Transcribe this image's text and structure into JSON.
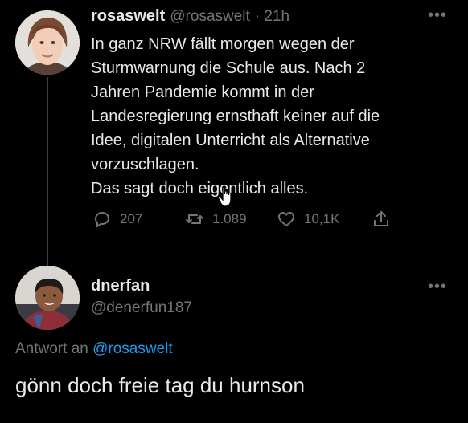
{
  "tweet": {
    "display_name": "rosaswelt",
    "handle": "@rosaswelt",
    "time": "· 21h",
    "more_icon": "more-dots-icon",
    "text": "In ganz NRW fällt morgen wegen der\nSturmwarnung die Schule aus. Nach 2\nJahren Pandemie kommt in der\nLandesregierung ernsthaft keiner auf die\nIdee, digitalen Unterricht als Alternative\nvorzuschlagen.\nDas sagt doch eigentlich alles.",
    "actions": {
      "reply_count": "207",
      "retweet_count": "1.089",
      "like_count": "10,1K"
    }
  },
  "reply": {
    "display_name": "dnerfan",
    "handle": "@denerfun187",
    "replying_prefix": "Antwort an",
    "replying_to": "@rosaswelt",
    "text": "gönn doch freie tag du hurnson"
  },
  "colors": {
    "background": "#000000",
    "text": "#e7e9ea",
    "muted": "#71767b",
    "link": "#1d9bf0"
  }
}
